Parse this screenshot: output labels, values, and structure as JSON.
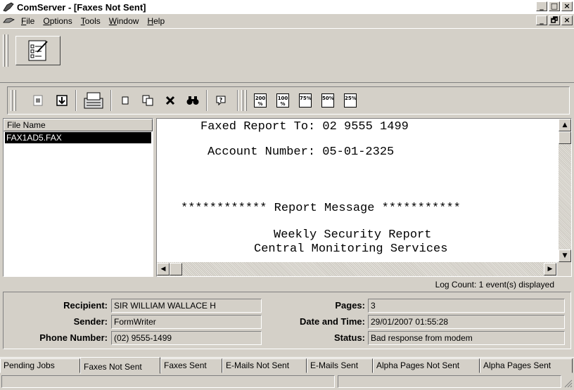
{
  "window": {
    "title": "ComServer - [Faxes Not Sent]",
    "controls": {
      "minimize": "_",
      "maximize": "□",
      "close": "×",
      "restore": "🗗"
    }
  },
  "menu": {
    "items": [
      {
        "label": "File",
        "u": "F",
        "rest": "ile"
      },
      {
        "label": "Options",
        "u": "O",
        "rest": "ptions"
      },
      {
        "label": "Tools",
        "u": "T",
        "rest": "ools"
      },
      {
        "label": "Window",
        "u": "W",
        "rest": "indow"
      },
      {
        "label": "Help",
        "u": "H",
        "rest": "elp"
      }
    ]
  },
  "toolbar": {
    "buttons": [
      "report",
      "import",
      "fax-machine",
      "new",
      "copy",
      "delete",
      "find",
      "help"
    ],
    "zoom": [
      "200",
      "100",
      "75",
      "50",
      "25"
    ]
  },
  "file_list": {
    "header": "File Name",
    "rows": [
      {
        "name": "FAX1AD5.FAX",
        "selected": true
      }
    ]
  },
  "document": {
    "lines": [
      "Faxed Report To: 02 9555 1499",
      "Account Number: 05-01-2325",
      "************ Report Message ***********",
      "Weekly Security Report",
      "Central Monitoring Services"
    ]
  },
  "log_count": "Log Count:  1 event(s) displayed",
  "details": {
    "recipient_label": "Recipient:",
    "recipient": "SIR WILLIAM WALLACE H",
    "sender_label": "Sender:",
    "sender": "FormWriter",
    "phone_label": "Phone Number:",
    "phone": "(02) 9555-1499",
    "pages_label": "Pages:",
    "pages": "3",
    "datetime_label": "Date and Time:",
    "datetime": "29/01/2007 01:55:28",
    "status_label": "Status:",
    "status": "Bad response from modem"
  },
  "tabs": [
    {
      "label": "Pending Jobs",
      "active": false
    },
    {
      "label": "Faxes Not Sent",
      "active": true
    },
    {
      "label": "Faxes Sent",
      "active": false
    },
    {
      "label": "E-Mails Not Sent",
      "active": false
    },
    {
      "label": "E-Mails Sent",
      "active": false
    },
    {
      "label": "Alpha Pages Not Sent",
      "active": false
    },
    {
      "label": "Alpha Pages Sent",
      "active": false
    }
  ]
}
